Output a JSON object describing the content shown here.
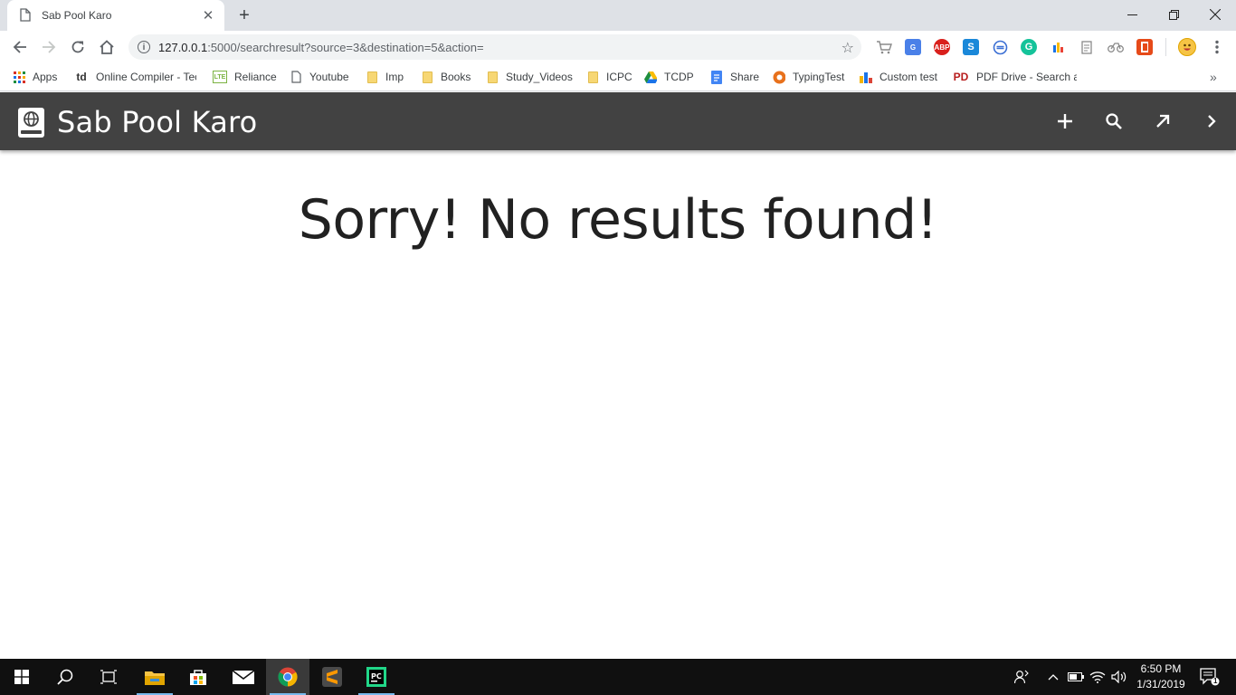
{
  "browser": {
    "tab_title": "Sab Pool Karo",
    "tab_close": "✕",
    "new_tab": "+",
    "url_host": "127.0.0.1",
    "url_rest": ":5000/searchresult?source=3&destination=5&action=",
    "bookmarks": [
      {
        "label": "Apps",
        "icon": "apps-grid-icon"
      },
      {
        "label": "Online Compiler - Tec",
        "icon": "td-icon"
      },
      {
        "label": "Reliance",
        "icon": "lte-icon"
      },
      {
        "label": "Youtube",
        "icon": "page-icon"
      },
      {
        "label": "Imp",
        "icon": "folder-icon"
      },
      {
        "label": "Books",
        "icon": "folder-icon"
      },
      {
        "label": "Study_Videos",
        "icon": "folder-icon"
      },
      {
        "label": "ICPC",
        "icon": "folder-icon"
      },
      {
        "label": "TCDP",
        "icon": "google-drive-icon"
      },
      {
        "label": "Share",
        "icon": "docs-icon"
      },
      {
        "label": "TypingTest",
        "icon": "typingtest-icon"
      },
      {
        "label": "Custom test",
        "icon": "bar-chart-icon"
      },
      {
        "label": "PDF Drive - Search ar",
        "icon": "pdf-drive-icon"
      }
    ],
    "more_bookmarks": "»",
    "extensions": {
      "abp": "ABP",
      "s": "S",
      "g": "G"
    }
  },
  "app": {
    "title": "Sab Pool Karo",
    "actions": [
      "add-icon",
      "search-icon",
      "arrow-up-right-icon",
      "chevron-right-icon"
    ],
    "header_color": "#424242"
  },
  "content": {
    "message": "Sorry! No results found!"
  },
  "taskbar": {
    "time": "6:50 PM",
    "date": "1/31/2019",
    "notification_count": "1"
  }
}
